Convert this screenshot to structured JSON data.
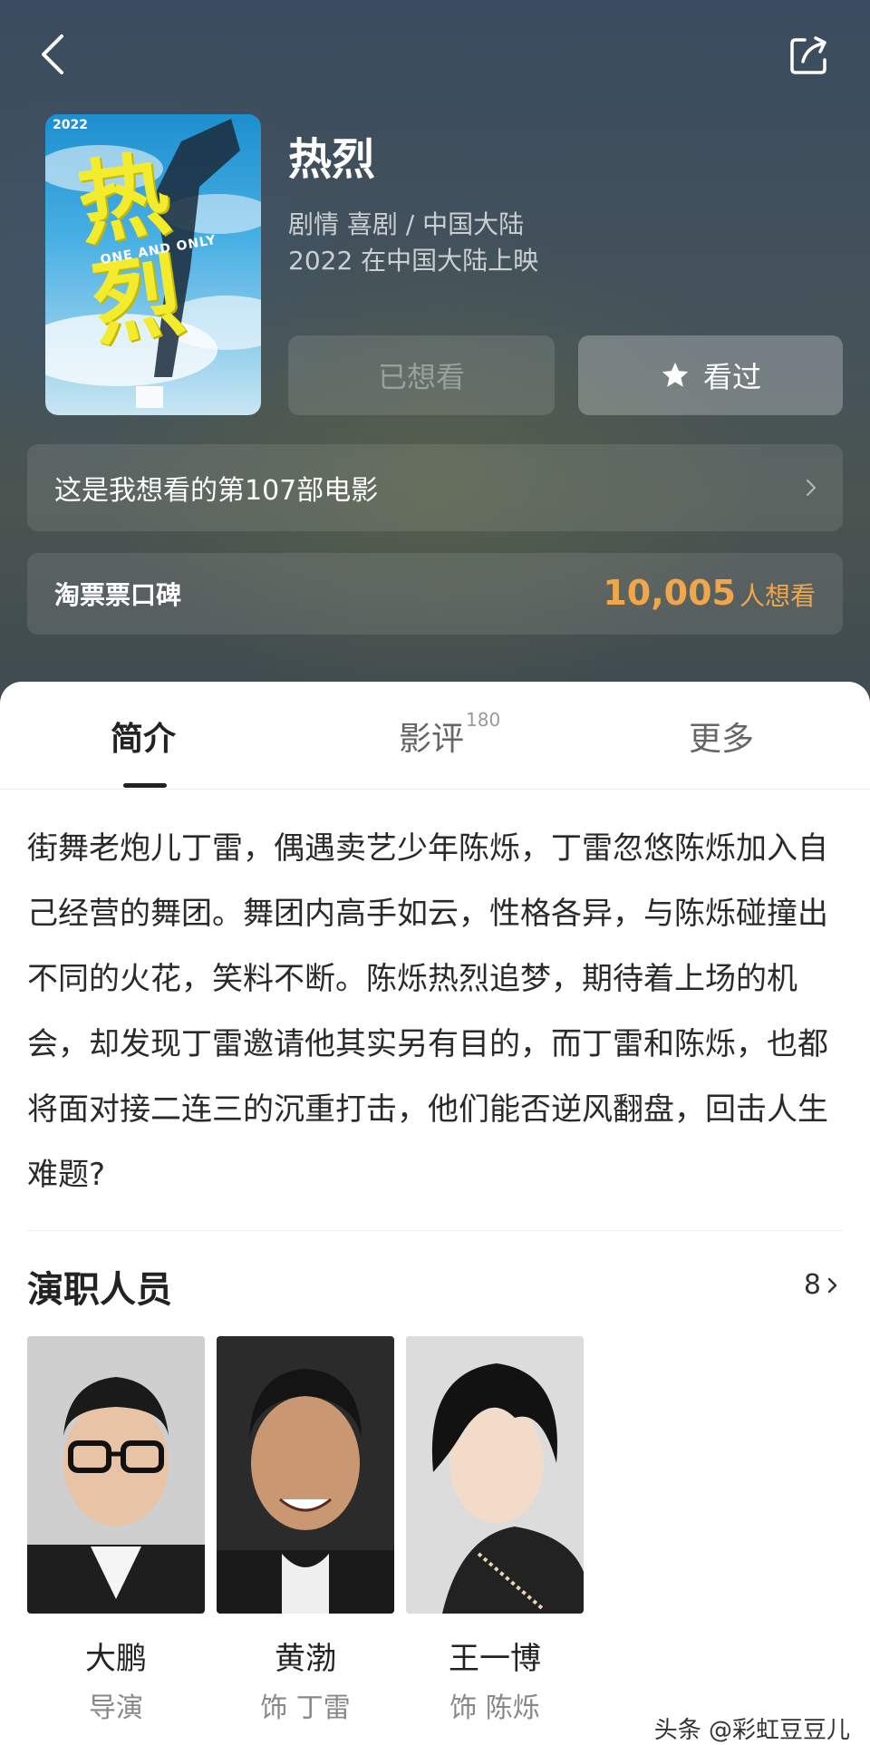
{
  "movie": {
    "title": "热烈",
    "genre_region": "剧情 喜剧 / 中国大陆",
    "release": "2022 在中国大陆上映",
    "poster": {
      "year": "2022",
      "main_title": "热烈",
      "english": "ONE AND ONLY"
    }
  },
  "actions": {
    "want_label": "已想看",
    "seen_label": "看过"
  },
  "want_note": "这是我想看的第107部电影",
  "rating": {
    "label": "淘票票口碑",
    "count": "10,005",
    "unit": "人想看"
  },
  "tabs": [
    {
      "label": "简介"
    },
    {
      "label": "影评",
      "badge": "180"
    },
    {
      "label": "更多"
    }
  ],
  "synopsis": "街舞老炮儿丁雷，偶遇卖艺少年陈烁，丁雷忽悠陈烁加入自己经营的舞团。舞团内高手如云，性格各异，与陈烁碰撞出不同的火花，笑料不断。陈烁热烈追梦，期待着上场的机会，却发现丁雷邀请他其实另有目的，而丁雷和陈烁，也都将面对接二连三的沉重打击，他们能否逆风翻盘，回击人生难题?",
  "cast": {
    "title": "演职人员",
    "count": "8",
    "members": [
      {
        "name": "大鹏",
        "role": "导演"
      },
      {
        "name": "黄渤",
        "role": "饰 丁雷"
      },
      {
        "name": "王一博",
        "role": "饰 陈烁"
      }
    ]
  },
  "watermark": "头条 @彩虹豆豆儿",
  "colors": {
    "accent_orange": "#f0a64a",
    "hero_bg": "#44525a"
  },
  "icons": [
    "back-arrow-icon",
    "share-icon",
    "star-icon",
    "chevron-right-icon"
  ]
}
